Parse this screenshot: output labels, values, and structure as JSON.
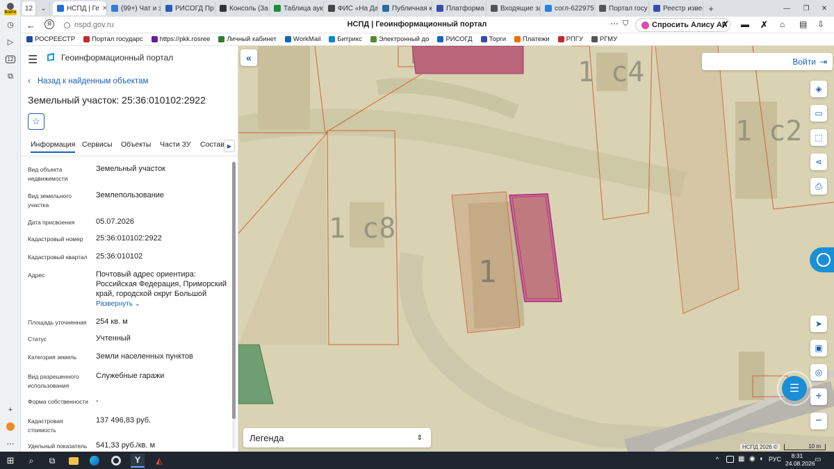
{
  "browser": {
    "tab_count": "12",
    "login_badge": "Войти",
    "tabs": [
      {
        "label": "НСПД | Ге",
        "color": "#1e6fd9"
      },
      {
        "label": "(99+) Чат и з",
        "color": "#3a7bd5"
      },
      {
        "label": "РИСОГД Пр",
        "color": "#2a5db0"
      },
      {
        "label": "Консоль (3а",
        "color": "#333333"
      },
      {
        "label": "Таблица аук",
        "color": "#1e8e3e"
      },
      {
        "label": "ФИС «На Да",
        "color": "#444444"
      },
      {
        "label": "Публичная к",
        "color": "#2a6f9e"
      },
      {
        "label": "Платформа г",
        "color": "#3a4db0"
      },
      {
        "label": "Входящие за",
        "color": "#555555"
      },
      {
        "label": "согл-622975",
        "color": "#2b7de9"
      },
      {
        "label": "Портал госу",
        "color": "#555555"
      },
      {
        "label": "Реестр извес",
        "color": "#3a4db0"
      }
    ],
    "new_tab": "+",
    "url": "nspd.gov.ru",
    "page_title": "НСПД | Геоинформационный портал",
    "alice": "Спросить Алису AI",
    "bookmarks": [
      {
        "label": "РОСРЕЕСТР",
        "color": "#1a4f9c"
      },
      {
        "label": "Портал государс",
        "color": "#c62828"
      },
      {
        "label": "https://pkk.rosree",
        "color": "#6a1b9a"
      },
      {
        "label": "Личный кабинет",
        "color": "#2e7d32"
      },
      {
        "label": "WorkMail",
        "color": "#1565c0"
      },
      {
        "label": "Битрикс",
        "color": "#0288d1"
      },
      {
        "label": "Электронный до",
        "color": "#558b2f"
      },
      {
        "label": "РИСОГД",
        "color": "#1565c0"
      },
      {
        "label": "Торги",
        "color": "#3949ab"
      },
      {
        "label": "Платежи",
        "color": "#ef6c00"
      },
      {
        "label": "РПГУ",
        "color": "#c62828"
      },
      {
        "label": "РГМУ",
        "color": "#555555"
      }
    ]
  },
  "portal": {
    "title": "Геоинформационный портал",
    "back": "Назад к найденным объектам",
    "object_title": "Земельный участок: 25:36:010102:2922",
    "tabs": [
      "Информация",
      "Сервисы",
      "Объекты",
      "Части ЗУ",
      "Состав"
    ],
    "expand": "Развернуть",
    "fields": [
      {
        "label": "Вид объекта недвижимости",
        "value": "Земельный участок"
      },
      {
        "label": "Вид земельного участка",
        "value": "Землепользование"
      },
      {
        "label": "Дата присвоения",
        "value": "05.07.2026"
      },
      {
        "label": "Кадастровый номер",
        "value": "25:36:010102:2922"
      },
      {
        "label": "Кадастровый квартал",
        "value": "25:36:010102"
      },
      {
        "label": "Адрес",
        "value": "Почтовый адрес ориентира: Российская Федерация, Приморский край, городской округ Большой"
      },
      {
        "label": "Площадь уточненная",
        "value": "254 кв. м"
      },
      {
        "label": "Статус",
        "value": "Учтенный"
      },
      {
        "label": "Категория земель",
        "value": "Земли населенных пунктов"
      },
      {
        "label": "Вид разрешенного использования",
        "value": "Служебные гаражи"
      },
      {
        "label": "Форма собственности",
        "value": "-"
      },
      {
        "label": "Кадастровая стоимость",
        "value": "137 496,83 руб."
      },
      {
        "label": "Удельный показатель",
        "value": "541,33 руб./кв. м"
      }
    ]
  },
  "map": {
    "login": "Войти",
    "legend": "Легенда",
    "copyright": "НСПД 2026 ©",
    "scale": "10 m",
    "labels": [
      {
        "text": "1 с4"
      },
      {
        "text": "1 с2"
      },
      {
        "text": "1 с8"
      },
      {
        "text": "1"
      }
    ]
  },
  "taskbar": {
    "lang": "РУС",
    "time": "8:31",
    "date": "24.08.2026"
  }
}
